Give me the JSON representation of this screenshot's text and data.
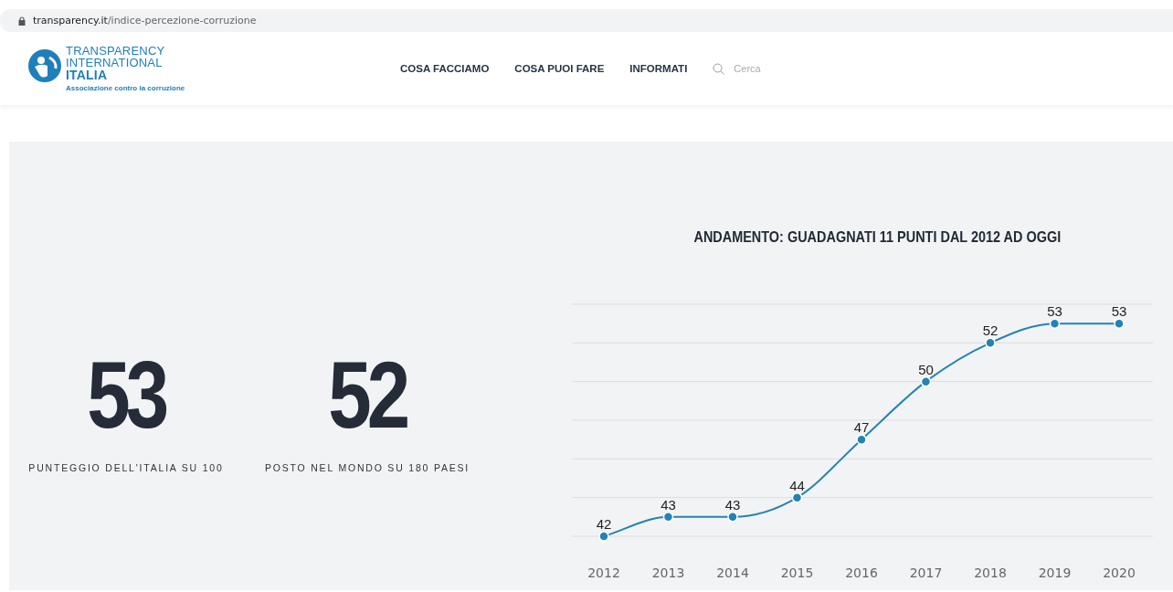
{
  "address_bar": {
    "domain": "transparency.it",
    "path": "/indice-percezione-corruzione"
  },
  "logo": {
    "lines": [
      "TRANSPARENCY",
      "INTERNATIONAL",
      "ITALIA"
    ],
    "tagline": "Associazione contro la corruzione"
  },
  "nav": {
    "items": [
      "COSA FACCIAMO",
      "COSA PUOI FARE",
      "INFORMATI"
    ],
    "search": {
      "placeholder": "Cerca"
    }
  },
  "stats": [
    {
      "value": "53",
      "label": "PUNTEGGIO DELL'ITALIA SU 100"
    },
    {
      "value": "52",
      "label": "POSTO NEL MONDO SU 180 PAESI"
    }
  ],
  "chart": {
    "title": "ANDAMENTO: GUADAGNATI 11 PUNTI DAL 2012 AD OGGI",
    "chart_data": {
      "type": "line",
      "categories": [
        "2012",
        "2013",
        "2014",
        "2015",
        "2016",
        "2017",
        "2018",
        "2019",
        "2020"
      ],
      "series": [
        {
          "color": "#2483b3",
          "marker": true,
          "values": [
            42,
            43,
            43,
            44,
            47,
            50,
            52,
            53,
            53
          ]
        }
      ],
      "ylim": [
        42,
        54
      ],
      "data_labels": true
    }
  }
}
